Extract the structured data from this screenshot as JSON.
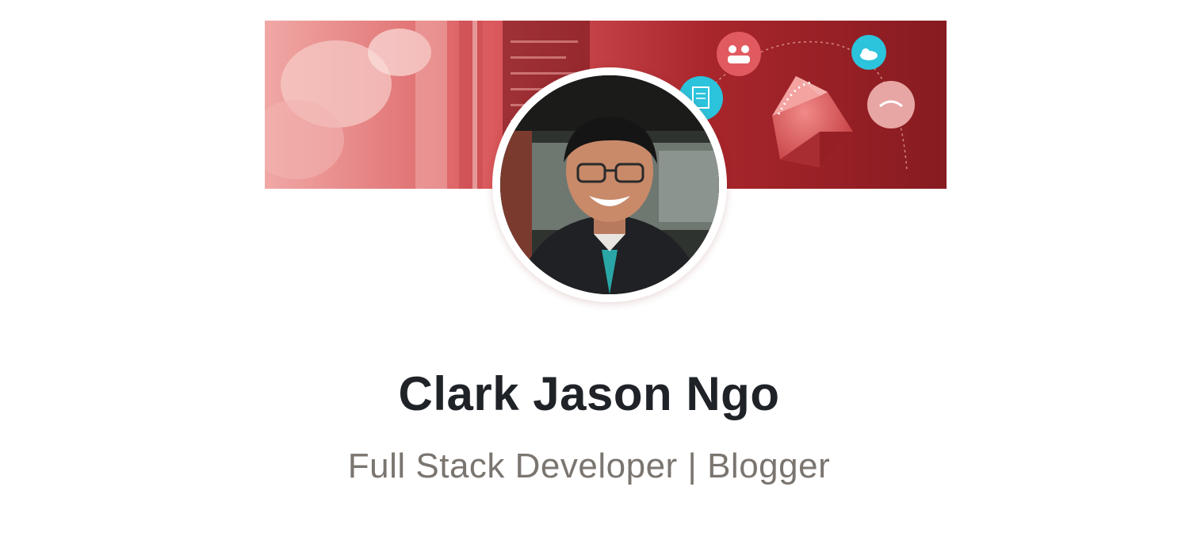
{
  "profile": {
    "name": "Clark Jason Ngo",
    "headline": "Full Stack Developer | Blogger"
  },
  "cover": {
    "icons": [
      "code-document-icon",
      "team-icon",
      "cloud-icon",
      "handshake-icon",
      "ruby-gem-icon"
    ]
  },
  "colors": {
    "banner_red": "#8a1f24",
    "banner_light": "#e77a7a",
    "accent_cyan": "#2cc3dc",
    "name_text": "#1f2328",
    "headline_text": "#7b7570"
  }
}
